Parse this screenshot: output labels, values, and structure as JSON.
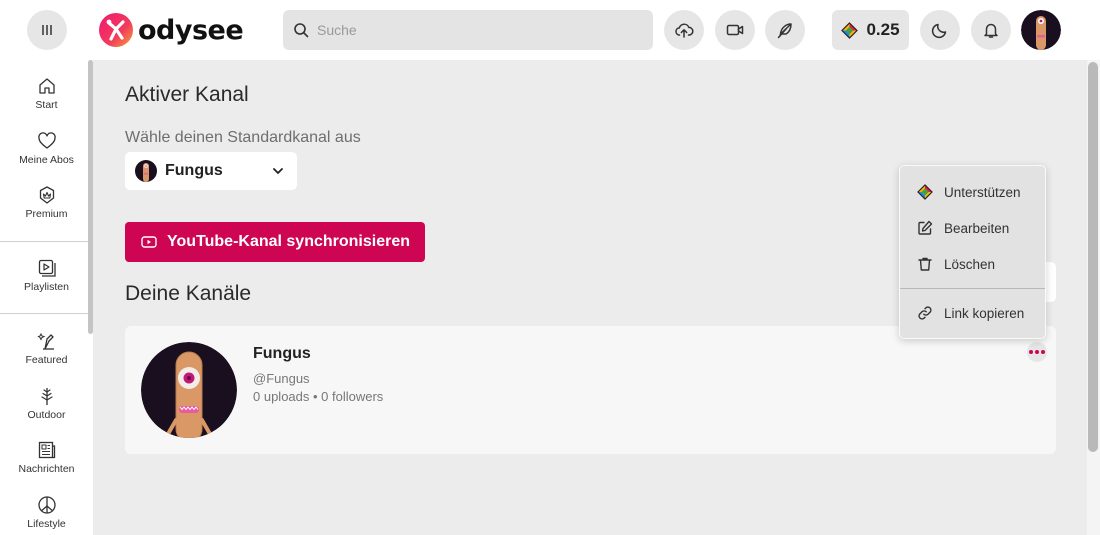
{
  "header": {
    "logo_text": "odysee",
    "search_placeholder": "Suche",
    "credits": "0.25"
  },
  "sidebar": {
    "items": [
      {
        "label": "Start",
        "icon": "home-icon"
      },
      {
        "label": "Meine Abos",
        "icon": "heart-icon"
      },
      {
        "label": "Premium",
        "icon": "premium-icon"
      },
      {
        "label": "Playlisten",
        "icon": "playlist-icon"
      },
      {
        "label": "Featured",
        "icon": "featured-icon"
      },
      {
        "label": "Outdoor",
        "icon": "tree-icon"
      },
      {
        "label": "Nachrichten",
        "icon": "news-icon"
      },
      {
        "label": "Lifestyle",
        "icon": "peace-icon"
      }
    ]
  },
  "main": {
    "active_title": "Aktiver Kanal",
    "choose_label": "Wähle deinen Standardkanal aus",
    "selected_channel": "Fungus",
    "youtube_button": "YouTube-Kanal synchronisieren",
    "channels_title": "Deine Kanäle",
    "card": {
      "name": "Fungus",
      "handle": "@Fungus",
      "stats": "0 uploads • 0 followers"
    }
  },
  "menu": {
    "items": [
      "Unterstützen",
      "Bearbeiten",
      "Löschen",
      "Link kopieren"
    ]
  },
  "colors": {
    "accent": "#cd0553",
    "background": "#ececec"
  }
}
